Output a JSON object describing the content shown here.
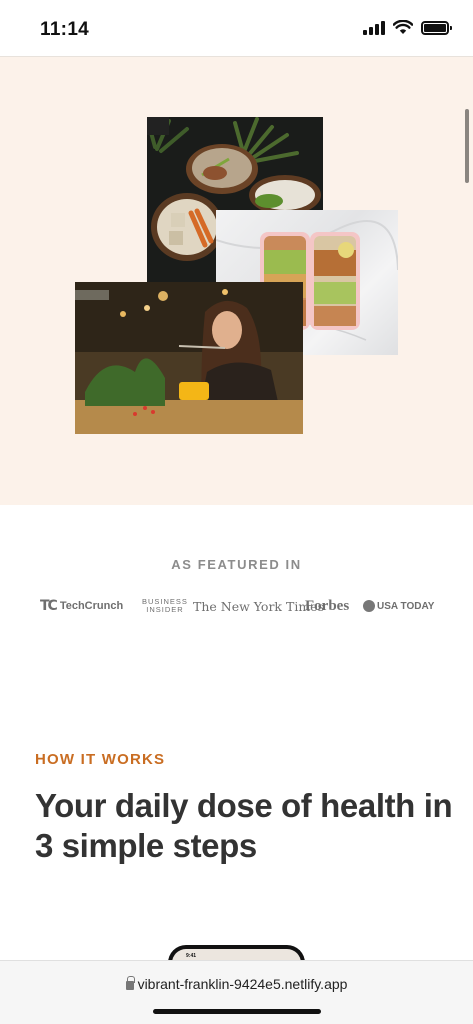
{
  "status_bar": {
    "time": "11:14"
  },
  "hero": {
    "images": [
      {
        "name": "poke-bowls-photo",
        "alt": "Bowls of food on dark table with plants"
      },
      {
        "name": "meal-prep-containers-photo",
        "alt": "Meal prep containers with chickpeas and avocado"
      },
      {
        "name": "woman-eating-photo",
        "alt": "Woman eating in a warmly lit cafe"
      }
    ]
  },
  "featured": {
    "label": "AS FEATURED IN",
    "logos": {
      "techcrunch": "TechCrunch",
      "tc_mark": "TC",
      "business_insider_line1": "BUSINESS",
      "business_insider_line2": "INSIDER",
      "nyt": "The New York Times",
      "forbes": "Forbes",
      "usa_today": "USA TODAY"
    }
  },
  "how_it_works": {
    "label": "HOW IT WORKS",
    "heading": "Your daily dose of health in 3 simple steps",
    "phone_time": "9:41"
  },
  "browser": {
    "url": "vibrant-franklin-9424e5.netlify.app"
  },
  "colors": {
    "hero_background": "#fcf2ea",
    "accent": "#c96d22",
    "heading": "#333333",
    "muted": "#8c8c8c"
  }
}
